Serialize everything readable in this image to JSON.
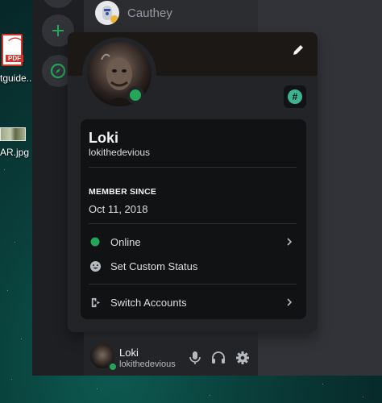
{
  "desktop": {
    "icons": [
      {
        "label": "tguide...",
        "icon": "pdf-icon",
        "badge": "PDF"
      },
      {
        "label": "AR.jpg",
        "icon": "image-file-icon"
      }
    ]
  },
  "server_rail": {
    "buttons": [
      {
        "name": "add-server-button",
        "icon": "plus-icon"
      },
      {
        "name": "explore-servers-button",
        "icon": "compass-icon"
      }
    ],
    "accent": "#23a55a"
  },
  "dm_list": {
    "items": [
      {
        "name": "Cauthey",
        "avatar": "robot-avatar"
      }
    ]
  },
  "profile": {
    "display_name": "Loki",
    "username": "lokithedevious",
    "status_color": "#23a55a",
    "badge_symbol": "#",
    "badge_color": "#3bb58f",
    "member_since_label": "MEMBER SINCE",
    "member_since_value": "Oct 11, 2018",
    "menu": [
      {
        "label": "Online",
        "icon": "online-dot-icon",
        "has_chevron": true
      },
      {
        "label": "Set Custom Status",
        "icon": "smile-icon",
        "has_chevron": false
      },
      {
        "label": "Switch Accounts",
        "icon": "switch-accounts-icon",
        "has_chevron": true
      }
    ]
  },
  "user_panel": {
    "name": "Loki",
    "handle": "lokithedevious",
    "buttons": [
      "microphone-icon",
      "headphones-icon",
      "settings-gear-icon"
    ]
  }
}
